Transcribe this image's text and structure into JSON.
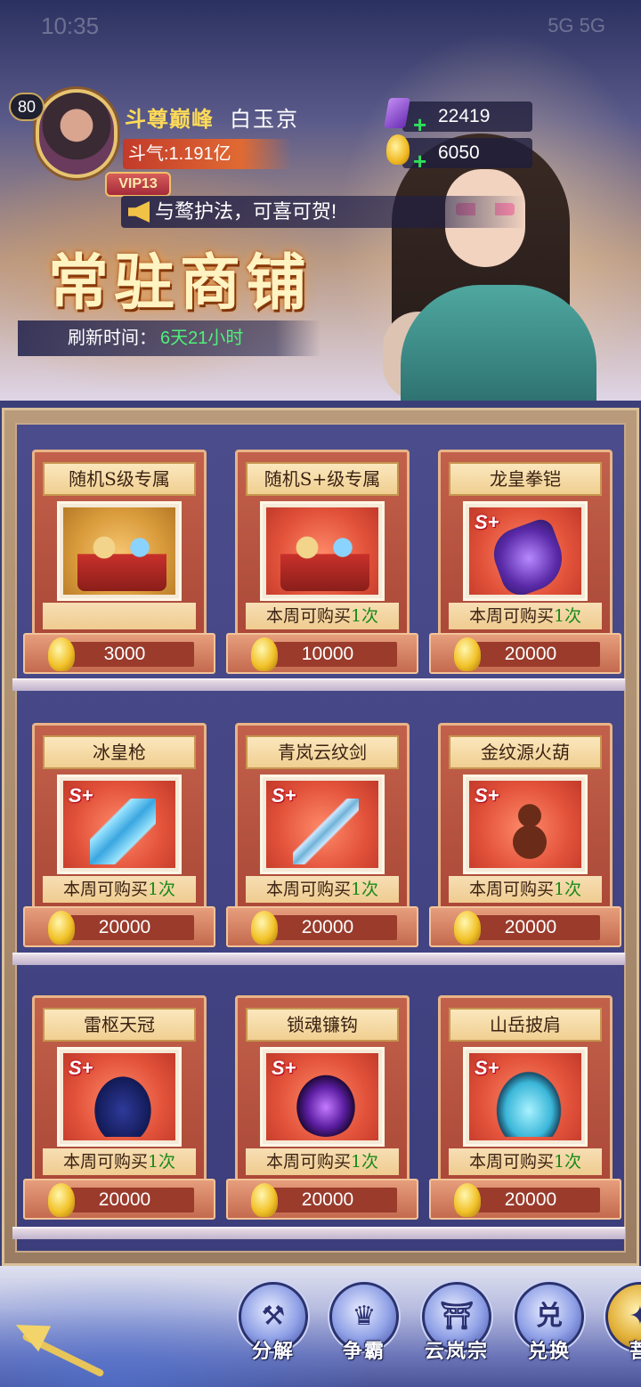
{
  "status": {
    "time": "10:35",
    "right": "5G 5G"
  },
  "player": {
    "level": "80",
    "title": "斗尊巅峰",
    "name": "白玉京",
    "power": "斗气:1.191亿",
    "vip": "VIP13"
  },
  "currency": {
    "gems": "22419",
    "gold": "6050"
  },
  "marquee": "与鹜护法，可喜可贺!",
  "shop": {
    "title": "常驻商铺",
    "refresh_label": "刷新时间：",
    "refresh_value": "6天21小时",
    "items": [
      {
        "name": "随机S级专属",
        "icon": "random-s-chest-icon",
        "limit_prefix": "",
        "limit_count": "",
        "price": "3000"
      },
      {
        "name": "随机S+级专属",
        "icon": "random-splus-chest-icon",
        "limit_prefix": "本周可购买",
        "limit_count": "1次",
        "price": "10000"
      },
      {
        "name": "龙皇拳铠",
        "icon": "dragon-gauntlet-icon",
        "limit_prefix": "本周可购买",
        "limit_count": "1次",
        "price": "20000"
      },
      {
        "name": "冰皇枪",
        "icon": "ice-spear-icon",
        "limit_prefix": "本周可购买",
        "limit_count": "1次",
        "price": "20000"
      },
      {
        "name": "青岚云纹剑",
        "icon": "cloud-sword-icon",
        "limit_prefix": "本周可购买",
        "limit_count": "1次",
        "price": "20000"
      },
      {
        "name": "金纹源火葫",
        "icon": "fire-gourd-icon",
        "limit_prefix": "本周可购买",
        "limit_count": "1次",
        "price": "20000"
      },
      {
        "name": "雷枢天冠",
        "icon": "thunder-crown-icon",
        "limit_prefix": "本周可购买",
        "limit_count": "1次",
        "price": "20000"
      },
      {
        "name": "锁魂镰钩",
        "icon": "soul-sickle-icon",
        "limit_prefix": "本周可购买",
        "limit_count": "1次",
        "price": "20000"
      },
      {
        "name": "山岳披肩",
        "icon": "mountain-pauldron-icon",
        "limit_prefix": "本周可购买",
        "limit_count": "1次",
        "price": "20000"
      }
    ],
    "grade_badge": "S+"
  },
  "nav": {
    "items": [
      {
        "label": "分解",
        "glyph": "⚒"
      },
      {
        "label": "争霸",
        "glyph": "♛"
      },
      {
        "label": "云岚宗",
        "glyph": "⛩"
      },
      {
        "label": "兑换",
        "glyph": "兑"
      },
      {
        "label": "菩",
        "glyph": "✦"
      }
    ]
  }
}
